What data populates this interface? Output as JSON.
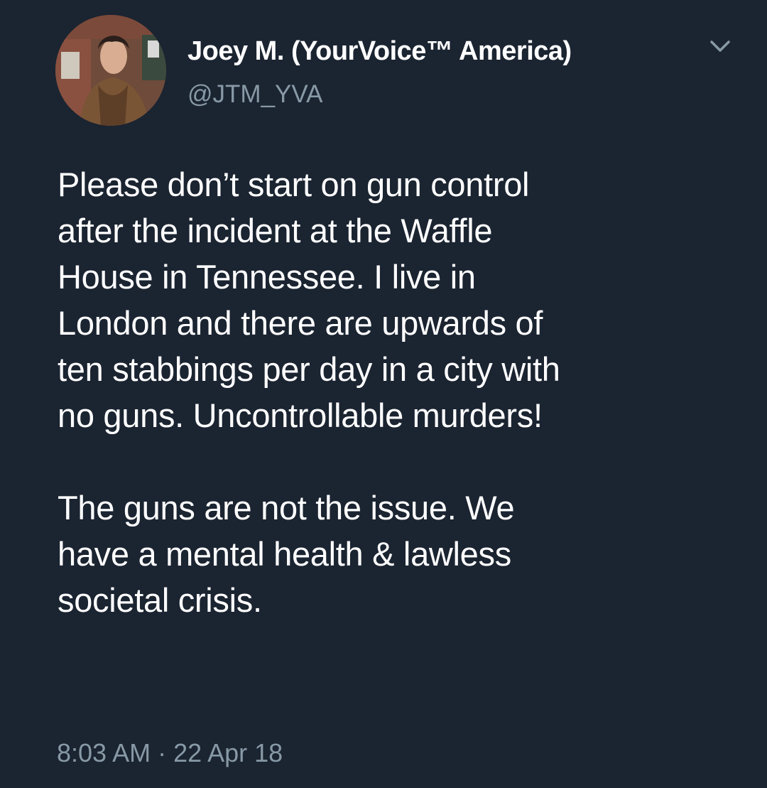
{
  "tweet": {
    "display_name": "Joey M. (YourVoice™ America)",
    "handle": "@JTM_YVA",
    "paragraphs": [
      "Please don’t start on gun control\nafter the incident at the Waffle\nHouse in Tennessee. I live in\nLondon and there are upwards of\nten stabbings per day in a city with\nno guns. Uncontrollable murders!",
      "The guns are not the issue. We\nhave a mental health & lawless\nsocietal crisis."
    ],
    "timestamp": "8:03 AM · 22 Apr 18",
    "menu_icon": "chevron-down-icon",
    "colors": {
      "background": "#1b2431",
      "text": "#ffffff",
      "secondary_text": "#8899a6"
    }
  }
}
